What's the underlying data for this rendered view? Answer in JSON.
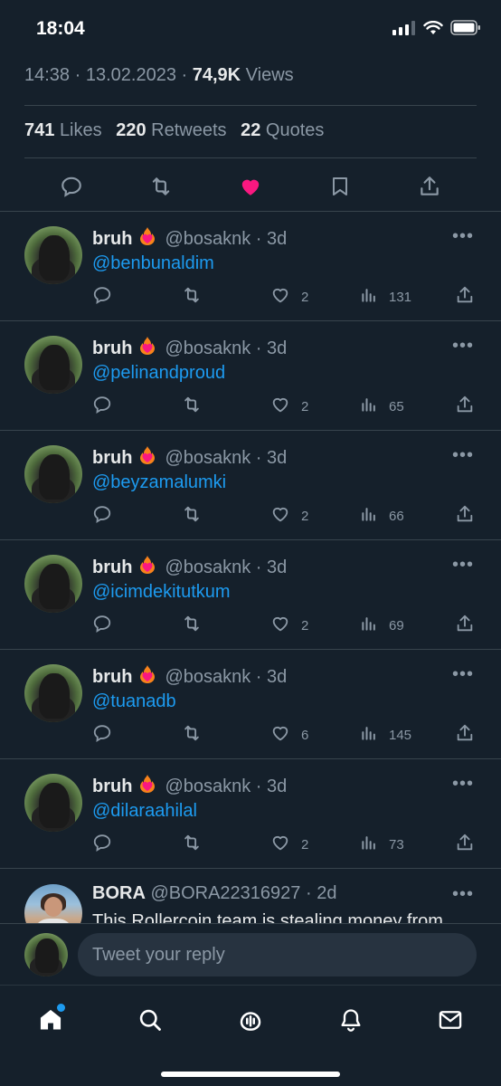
{
  "status_bar": {
    "time": "18:04"
  },
  "tweet_meta": {
    "time": "14:38",
    "date": "13.02.2023",
    "views_count": "74,9K",
    "views_label": "Views"
  },
  "stats": {
    "likes_count": "741",
    "likes_label": "Likes",
    "retweets_count": "220",
    "retweets_label": "Retweets",
    "quotes_count": "22",
    "quotes_label": "Quotes"
  },
  "replies": [
    {
      "name": "bruh",
      "handle": "@bosaknk",
      "age": "3d",
      "mention": "@benbunaldim",
      "likes": "2",
      "views": "131"
    },
    {
      "name": "bruh",
      "handle": "@bosaknk",
      "age": "3d",
      "mention": "@pelinandproud",
      "likes": "2",
      "views": "65"
    },
    {
      "name": "bruh",
      "handle": "@bosaknk",
      "age": "3d",
      "mention": "@beyzamalumki",
      "likes": "2",
      "views": "66"
    },
    {
      "name": "bruh",
      "handle": "@bosaknk",
      "age": "3d",
      "mention": "@icimdekitutkum",
      "likes": "2",
      "views": "69"
    },
    {
      "name": "bruh",
      "handle": "@bosaknk",
      "age": "3d",
      "mention": "@tuanadb",
      "likes": "6",
      "views": "145"
    },
    {
      "name": "bruh",
      "handle": "@bosaknk",
      "age": "3d",
      "mention": "@dilaraahilal",
      "likes": "2",
      "views": "73"
    }
  ],
  "last_reply": {
    "name": "BORA",
    "handle": "@BORA22316927",
    "age": "2d",
    "text": "This Rollercoin team is stealing money from"
  },
  "compose": {
    "placeholder": "Tweet your reply"
  },
  "colors": {
    "background": "#15202b",
    "accent": "#1d9bf0",
    "like": "#f91880",
    "muted": "#8b98a5"
  },
  "icons": {
    "tweet_actions": [
      "reply-icon",
      "retweet-icon",
      "liked-heart-icon",
      "bookmark-icon",
      "share-icon"
    ],
    "tab_bar": [
      "home-icon",
      "search-icon",
      "spaces-icon",
      "notifications-icon",
      "messages-icon"
    ]
  }
}
